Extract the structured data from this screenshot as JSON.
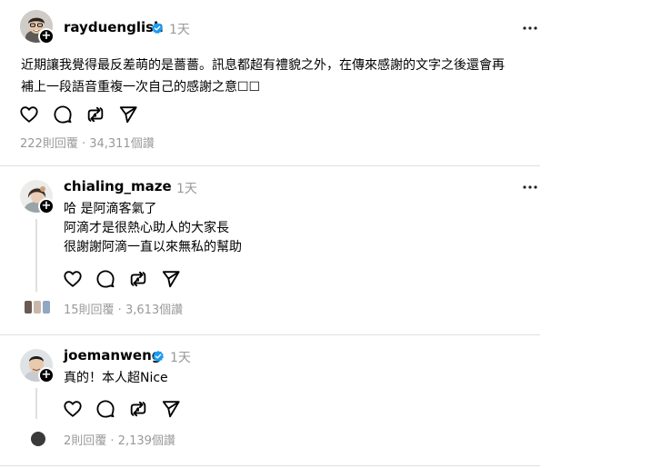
{
  "main_post": {
    "username": "rayduenglish",
    "time": "1天",
    "text_line1": "近期讓我覺得最反差萌的是薔薔。訊息都超有禮貌之外，在傳來感謝的文字之後還會再",
    "text_line2": "補上一段語音重複一次自己的感謝之意☐☐",
    "stats": "222則回覆 · 34,311個讚"
  },
  "replies": [
    {
      "username": "chialing_maze",
      "time": "1天",
      "lines": [
        "哈 是阿滴客氣了",
        "阿滴才是很熱心助人的大家長",
        "很謝謝阿滴一直以來無私的幫助"
      ],
      "stats": "15則回覆 · 3,613個讚"
    },
    {
      "username": "joemanweng",
      "time": "1天",
      "lines": [
        "真的！本人超Nice"
      ],
      "stats": "2則回覆 · 2,139個讚"
    }
  ],
  "icons": [
    "heart-icon",
    "comment-icon",
    "repost-icon",
    "share-icon",
    "more-icon",
    "verified-icon",
    "follow-plus-icon"
  ],
  "colors": {
    "verified": "#1d9bf0",
    "muted": "#999999",
    "divider": "#e0e0e0"
  }
}
